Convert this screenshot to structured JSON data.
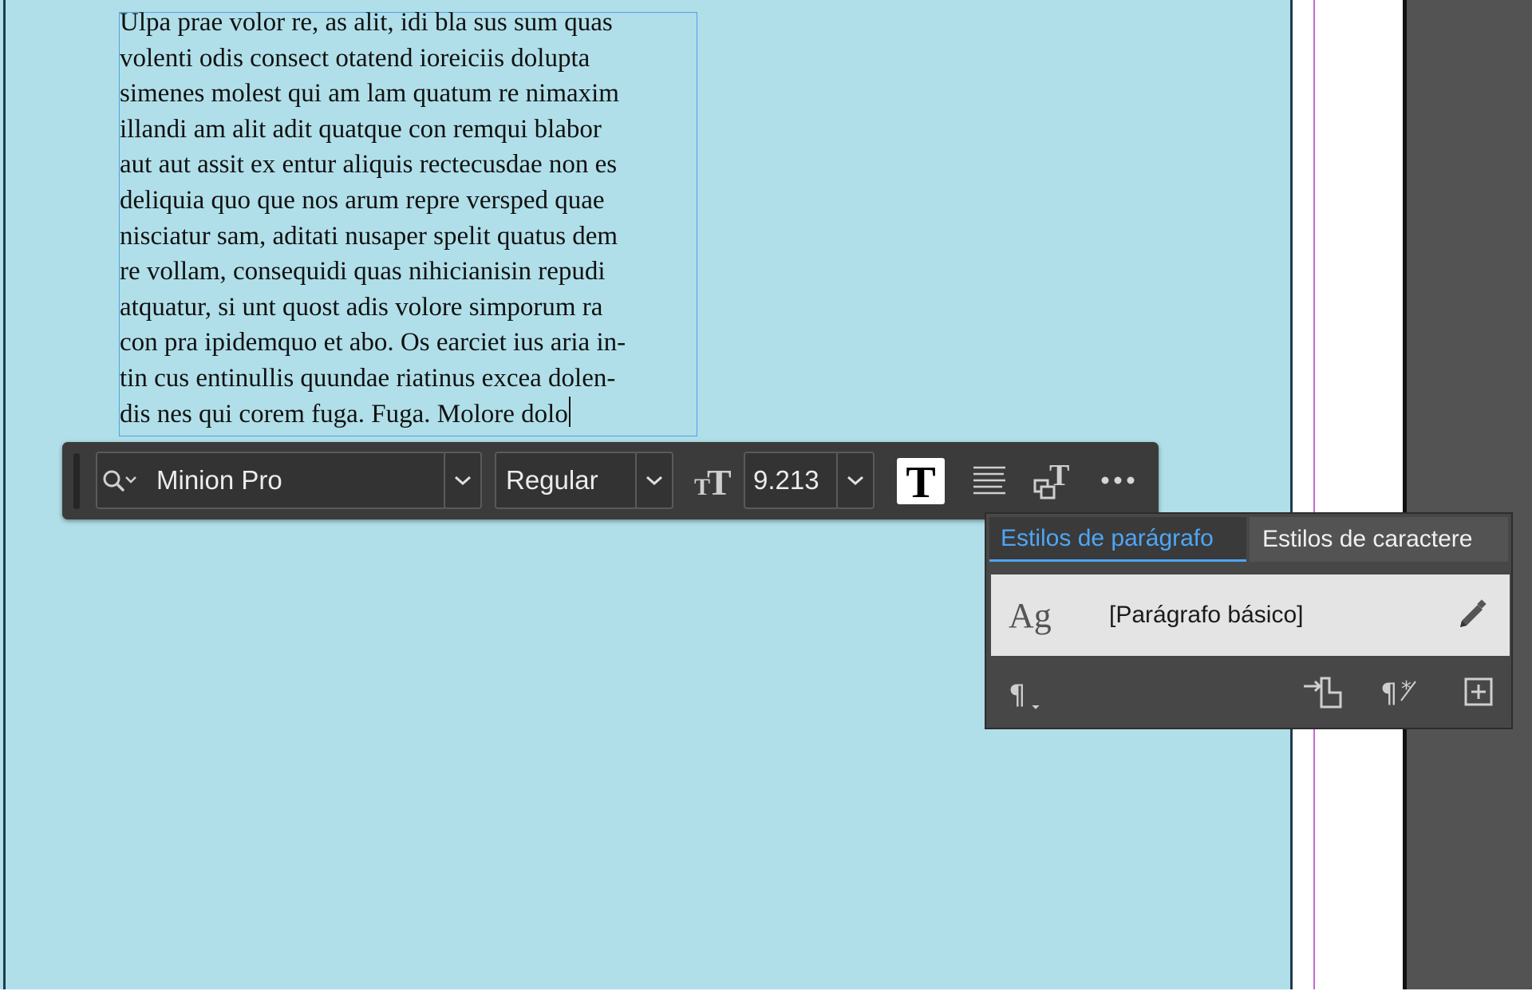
{
  "document": {
    "body_lines": [
      "Ulpa prae volor re, as alit, idi bla sus sum quas",
      "volenti odis consect otatend ioreiciis dolupta",
      "simenes molest qui am lam quatum re nimaxim",
      "illandi am alit adit quatque con remqui blabor",
      "aut aut assit ex entur aliquis rectecusdae non es",
      "deliquia quo que nos arum repre versped quae",
      "nisciatur sam, aditati nusaper spelit quatus dem",
      "re vollam, consequidi quas nihicianisin repudi",
      "atquatur, si unt quost adis volore simporum ra",
      "con pra ipidemquo et abo. Os earciet ius aria in-",
      "tin cus entinullis quundae riatinus excea dolen-",
      "dis nes qui corem fuga. Fuga. Molore dolo"
    ]
  },
  "toolbar": {
    "font_family": "Minion Pro",
    "font_style": "Regular",
    "font_size": "9.213",
    "icons": {
      "search": "search-icon",
      "dropdown": "chevron-down-icon",
      "size": "font-size-icon",
      "char_format": "text-format-icon",
      "align": "align-left-icon",
      "frame_fit": "text-frame-options-icon",
      "more": "more-options-icon"
    }
  },
  "styles_panel": {
    "tabs": [
      {
        "label": "Estilos de parágrafo",
        "active": true
      },
      {
        "label": "Estilos de caractere",
        "active": false
      }
    ],
    "selected_style": {
      "preview": "Ag",
      "name": "[Parágrafo básico]"
    },
    "footer_icons": [
      "paragraph-menu-icon",
      "load-styles-icon",
      "clear-overrides-icon",
      "new-style-icon"
    ]
  },
  "colors": {
    "page_background": "#b0dfe9",
    "pasteboard_dark": "#535353",
    "accent": "#4ea6f5",
    "margin_guide": "#c46bd3"
  }
}
